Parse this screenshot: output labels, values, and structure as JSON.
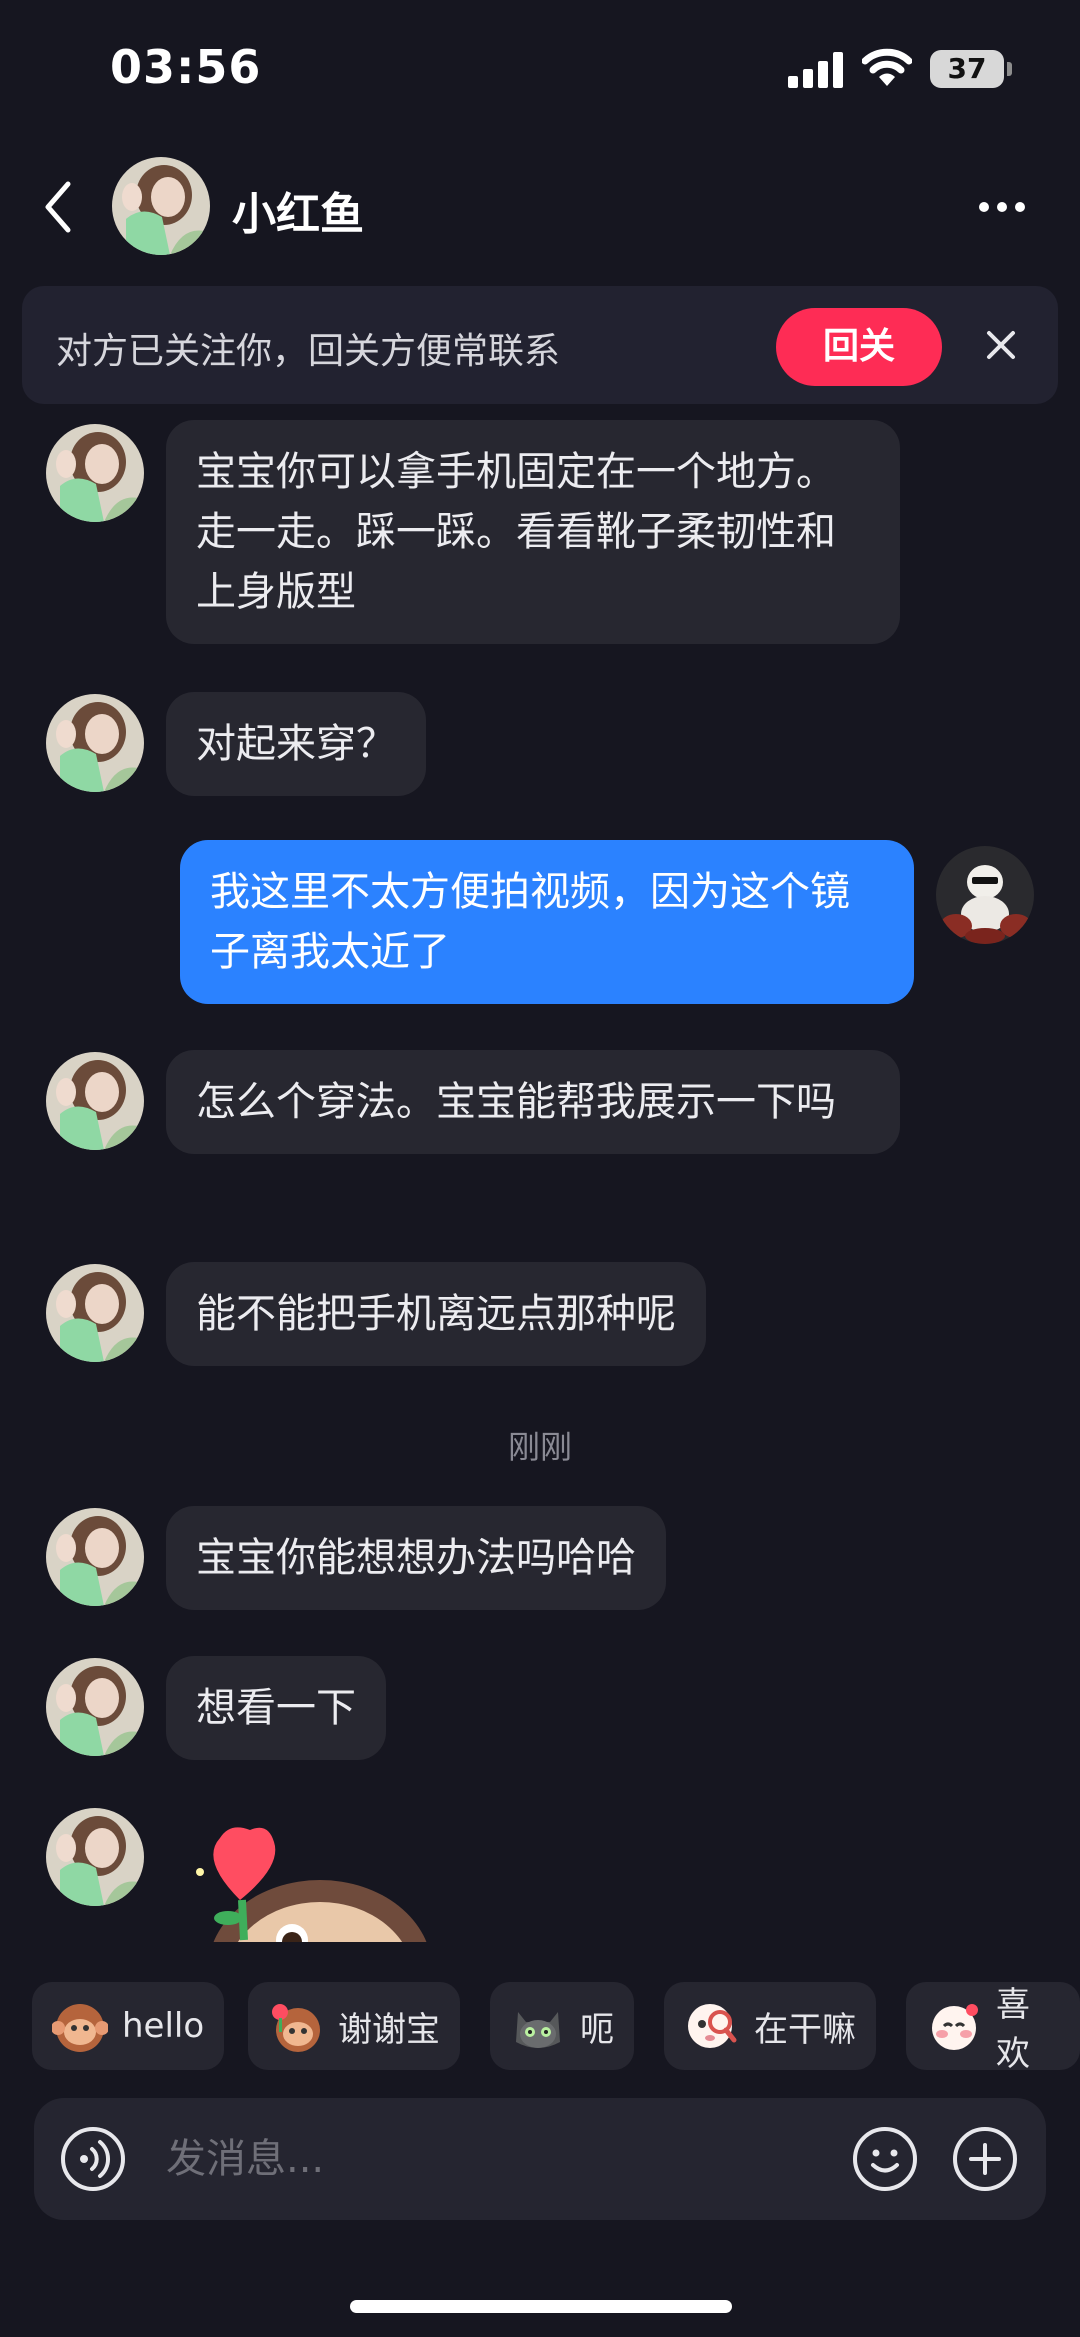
{
  "status_bar": {
    "time": "03:56",
    "battery": "37",
    "icons": [
      "signal-icon",
      "wifi-icon",
      "battery-icon"
    ]
  },
  "header": {
    "contact_name": "小红鱼",
    "icons": [
      "back-icon",
      "more-icon"
    ]
  },
  "follow_banner": {
    "text": "对方已关注你，回关方便常联系",
    "button_label": "回关",
    "close_icon": "close-icon"
  },
  "messages": [
    {
      "from": "them",
      "text": "宝宝你可以拿手机固定在一个地方。走一走。踩一踩。看看靴子柔韧性和上身版型"
    },
    {
      "from": "them",
      "text": "对起来穿？"
    },
    {
      "from": "me",
      "text": "我这里不太方便拍视频，因为这个镜子离我太近了"
    },
    {
      "from": "them",
      "text": "怎么个穿法。宝宝能帮我展示一下吗"
    },
    {
      "from": "them",
      "text": "能不能把手机离远点那种呢"
    },
    {
      "from": "them",
      "text": "宝宝你能想想办法吗哈哈"
    },
    {
      "from": "them",
      "text": "想看一下"
    },
    {
      "from": "them",
      "type": "sticker",
      "sticker": "rose-face-sticker"
    }
  ],
  "time_separator": "刚刚",
  "quick_replies": [
    {
      "label": "hello",
      "icon": "monkey-emoji-icon"
    },
    {
      "label": "谢谢宝",
      "icon": "monkey-rose-emoji-icon"
    },
    {
      "label": "呃",
      "icon": "cat-emoji-icon"
    },
    {
      "label": "在干嘛",
      "icon": "search-face-emoji-icon"
    },
    {
      "label": "喜欢",
      "icon": "blush-face-emoji-icon"
    }
  ],
  "input": {
    "placeholder": "发消息...",
    "value": "",
    "icons": [
      "voice-icon",
      "emoji-icon",
      "plus-icon"
    ]
  },
  "colors": {
    "background": "#161620",
    "bubble_them": "#272730",
    "bubble_me": "#2b82ff",
    "follow_button": "#fe2c55"
  }
}
